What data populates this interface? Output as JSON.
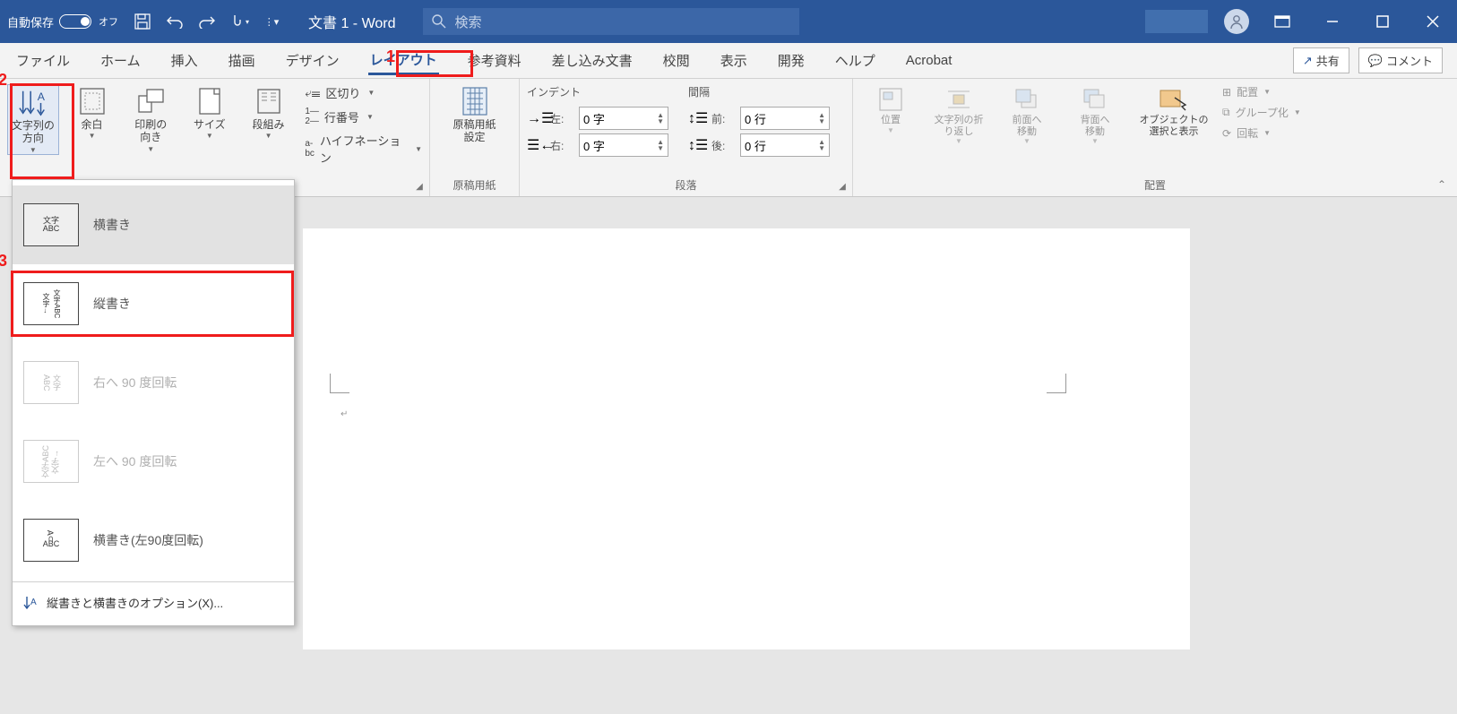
{
  "title_bar": {
    "autosave_label": "自動保存",
    "autosave_state": "オフ",
    "doc_title": "文書 1 - Word",
    "search_placeholder": "検索"
  },
  "tabs": [
    "ファイル",
    "ホーム",
    "挿入",
    "描画",
    "デザイン",
    "レイアウト",
    "参考資料",
    "差し込み文書",
    "校閲",
    "表示",
    "開発",
    "ヘルプ",
    "Acrobat"
  ],
  "active_tab_index": 5,
  "share_label": "共有",
  "comment_label": "コメント",
  "ribbon": {
    "page_setup": {
      "text_direction": "文字列の\n方向",
      "margins": "余白",
      "orientation": "印刷の\n向き",
      "size": "サイズ",
      "columns": "段組み",
      "breaks": "区切り",
      "line_numbers": "行番号",
      "hyphenation": "ハイフネーション",
      "group_label": ""
    },
    "manuscript": {
      "button": "原稿用紙\n設定",
      "group_label": "原稿用紙"
    },
    "paragraph": {
      "indent_head": "インデント",
      "spacing_head": "間隔",
      "left_label": "左:",
      "right_label": "右:",
      "before_label": "前:",
      "after_label": "後:",
      "left_val": "0 字",
      "right_val": "0 字",
      "before_val": "0 行",
      "after_val": "0 行",
      "group_label": "段落"
    },
    "arrange": {
      "position": "位置",
      "wrap": "文字列の折\nり返し",
      "bring_fwd": "前面へ\n移動",
      "send_back": "背面へ\n移動",
      "selection_pane": "オブジェクトの\n選択と表示",
      "align": "配置",
      "group": "グループ化",
      "rotate": "回転",
      "group_label": "配置"
    }
  },
  "dropdown": {
    "items": [
      {
        "label": "横書き",
        "kind": "horizontal"
      },
      {
        "label": "縦書き",
        "kind": "vertical"
      },
      {
        "label": "右へ 90 度回転",
        "kind": "rot-right",
        "disabled": true
      },
      {
        "label": "左へ 90 度回転",
        "kind": "rot-left",
        "disabled": true
      },
      {
        "label": "横書き(左90度回転)",
        "kind": "horiz-rot"
      }
    ],
    "footer": "縦書きと横書きのオプション(X)..."
  },
  "annotations": {
    "n1": "1",
    "n2": "2",
    "n3": "3"
  }
}
